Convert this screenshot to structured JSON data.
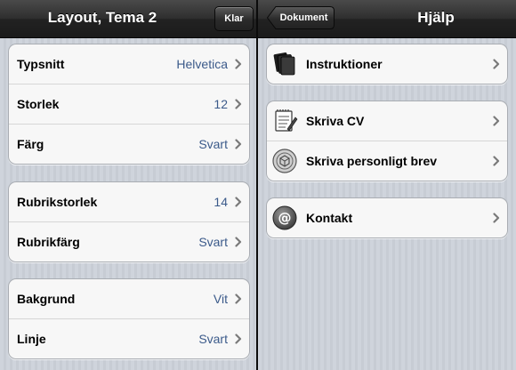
{
  "left": {
    "title": "Layout, Tema 2",
    "done_label": "Klar",
    "groups": [
      [
        {
          "label": "Typsnitt",
          "value": "Helvetica"
        },
        {
          "label": "Storlek",
          "value": "12"
        },
        {
          "label": "Färg",
          "value": "Svart"
        }
      ],
      [
        {
          "label": "Rubrikstorlek",
          "value": "14"
        },
        {
          "label": "Rubrikfärg",
          "value": "Svart"
        }
      ],
      [
        {
          "label": "Bakgrund",
          "value": "Vit"
        },
        {
          "label": "Linje",
          "value": "Svart"
        }
      ]
    ]
  },
  "right": {
    "title": "Hjälp",
    "back_label": "Dokument",
    "items": {
      "instructions": {
        "label": "Instruktioner",
        "icon": "documents-icon"
      },
      "write_cv": {
        "label": "Skriva CV",
        "icon": "notepad-icon"
      },
      "write_letter": {
        "label": "Skriva personligt brev",
        "icon": "seal-icon"
      },
      "contact": {
        "label": "Kontakt",
        "icon": "at-sign-icon"
      }
    }
  },
  "colors": {
    "value_text": "#3b5a8a",
    "navbar": "#2a2a2a",
    "background": "#cfd4dc"
  }
}
